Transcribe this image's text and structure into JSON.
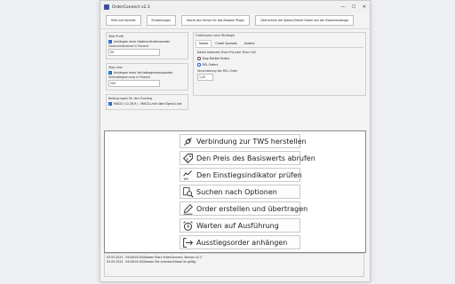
{
  "window": {
    "title": "OrderConnect v2.3",
    "controls": {
      "minimize": "—",
      "maximize": "☐",
      "close": "✕"
    }
  },
  "toolbar": {
    "buttons": [
      {
        "label": "Hilfe und Kontakt"
      },
      {
        "label": "Einstellungen"
      },
      {
        "label": "Starte den Server für das Browser Plugin"
      },
      {
        "label": "Übernehme die Option/Ordner Daten aus der Zwischenablage"
      }
    ]
  },
  "take_profit": {
    "title": "Take Profit",
    "checkbox_label": "Anhängen einer Gewinnmitnahmeorder",
    "field_label": "Gewinnmitnahme in Prozent",
    "field_value": "50"
  },
  "stop_loss": {
    "title": "Stop Loss",
    "checkbox_label": "Anhängen einer Verlustbegrenzungsorder",
    "field_label": "Verlustbegrenzung in Prozent",
    "field_value": "200"
  },
  "entry_conditions": {
    "title": "Bedingungen für den Einstieg",
    "checkbox_label": "MACD ( 12,26,9 ) - MACD-Linie über Signal-Linie"
  },
  "order_strategy": {
    "title": "Ordertypen nach Strategie",
    "tabs": [
      {
        "label": "Naked"
      },
      {
        "label": "Credit Spreads"
      },
      {
        "label": "Andere"
      }
    ],
    "description": "Naked bedeutet Short Put oder Short Call",
    "radio_options": [
      {
        "label": "Stop Market Orders",
        "selected": false
      },
      {
        "label": "REL Orders",
        "selected": true
      }
    ],
    "field_label": "Verschiebung der REL-Order",
    "field_value": "1,00"
  },
  "steps": [
    {
      "label": "Verbindung zur TWS herstellen",
      "icon": "plug-icon"
    },
    {
      "label": "Den Preis des Basiswerts abrufen",
      "icon": "price-tag-icon"
    },
    {
      "label": "Den Einstiegsindikator prüfen",
      "icon": "kpi-chart-icon"
    },
    {
      "label": "Suchen nach Optionen",
      "icon": "search-icon"
    },
    {
      "label": "Order erstellen und übertragen",
      "icon": "pencil-icon"
    },
    {
      "label": "Warten auf Ausführung",
      "icon": "alarm-clock-icon"
    },
    {
      "label": "Ausstiegsorder anhängen",
      "icon": "sign-out-icon"
    }
  ],
  "log": [
    "03.05.2023 - 09:08:00 $5/Sessen Start OrderConnect, Version v2.3",
    "03.05.2023 - 09:08:00 $5/Sessen Die Lizenzschlüssel ist gültig."
  ]
}
